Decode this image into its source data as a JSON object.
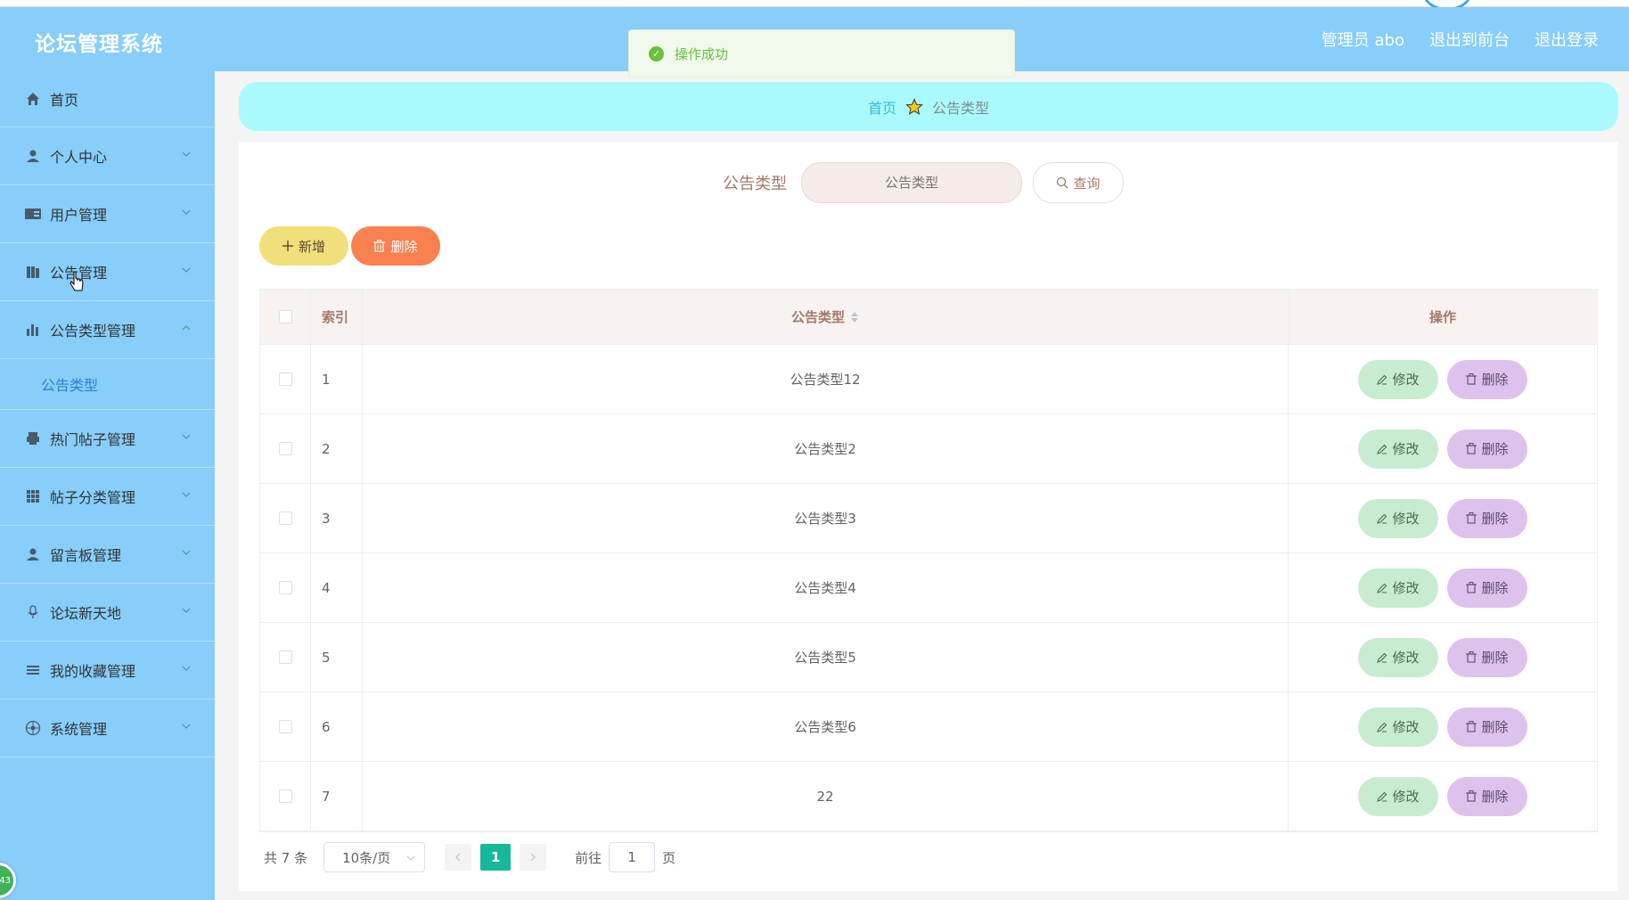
{
  "header": {
    "app_title": "论坛管理系统",
    "admin_label": "管理员 abo",
    "exit_front": "退出到前台",
    "logout": "退出登录"
  },
  "toast": {
    "message": "操作成功"
  },
  "sidebar": {
    "items": [
      {
        "label": "首页",
        "icon": "home-icon"
      },
      {
        "label": "个人中心",
        "icon": "user-icon"
      },
      {
        "label": "用户管理",
        "icon": "id-card-icon"
      },
      {
        "label": "公告管理",
        "icon": "notice-icon"
      },
      {
        "label": "公告类型管理",
        "icon": "bar-chart-icon"
      },
      {
        "label": "热门帖子管理",
        "icon": "printer-icon"
      },
      {
        "label": "帖子分类管理",
        "icon": "grid-icon"
      },
      {
        "label": "留言板管理",
        "icon": "person-icon"
      },
      {
        "label": "论坛新天地",
        "icon": "mic-icon"
      },
      {
        "label": "我的收藏管理",
        "icon": "list-icon"
      },
      {
        "label": "系统管理",
        "icon": "compass-icon"
      }
    ],
    "sub_item": "公告类型",
    "float_badge": "43"
  },
  "breadcrumb": {
    "home": "首页",
    "current": "公告类型"
  },
  "search": {
    "label": "公告类型",
    "placeholder": "公告类型",
    "button": "查询"
  },
  "actions": {
    "add": "新增",
    "delete": "删除"
  },
  "table": {
    "headers": {
      "index": "索引",
      "type": "公告类型",
      "ops": "操作"
    },
    "rows": [
      {
        "index": "1",
        "type": "公告类型12"
      },
      {
        "index": "2",
        "type": "公告类型2"
      },
      {
        "index": "3",
        "type": "公告类型3"
      },
      {
        "index": "4",
        "type": "公告类型4"
      },
      {
        "index": "5",
        "type": "公告类型5"
      },
      {
        "index": "6",
        "type": "公告类型6"
      },
      {
        "index": "7",
        "type": "22"
      }
    ],
    "edit_label": "修改",
    "delete_label": "删除"
  },
  "pagination": {
    "total": "共 7 条",
    "page_size": "10条/页",
    "current_page": "1",
    "goto_prefix": "前往",
    "goto_value": "1",
    "goto_suffix": "页"
  },
  "colors": {
    "header_bg": "#87cefa",
    "breadcrumb_bg": "#aafafd",
    "add_btn": "#f0df7b",
    "delete_btn": "#f9804f",
    "edit_btn": "#c8ecd0",
    "row_delete_btn": "#dec2ee",
    "active_page": "#16b899"
  }
}
